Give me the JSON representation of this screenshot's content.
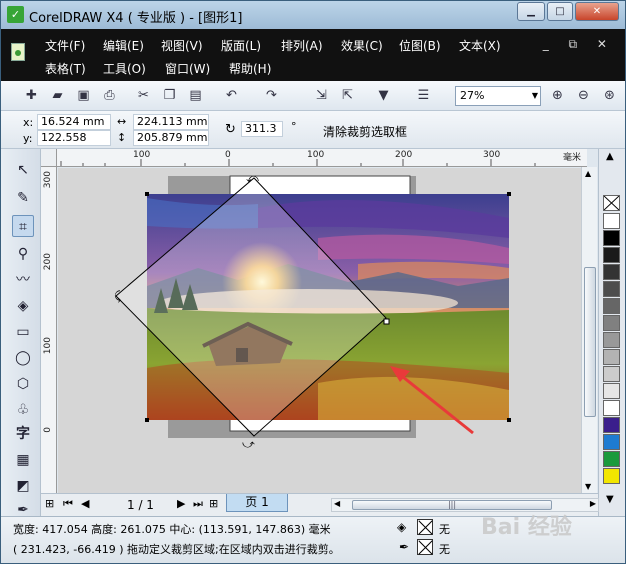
{
  "window": {
    "title": "CorelDRAW X4 ( 专业版 ) - [图形1]",
    "minimize_label": "▁",
    "maximize_label": "□",
    "close_label": "✕"
  },
  "menu": {
    "row1": [
      "文件(F)",
      "编辑(E)",
      "视图(V)",
      "版面(L)",
      "排列(A)",
      "效果(C)",
      "位图(B)",
      "文本(X)"
    ],
    "row2": [
      "表格(T)",
      "工具(O)",
      "窗口(W)",
      "帮助(H)"
    ],
    "mdi_controls": "_ ⧉ ✕"
  },
  "toolbar": {
    "zoom_value": "27%"
  },
  "property_bar": {
    "x_label": "x:",
    "x_value": "16.524 mm",
    "y_label": "y:",
    "y_value": "122.558 mm",
    "width_value": "224.113 mm",
    "height_value": "205.879 mm",
    "rotation_value": "311.3",
    "rotation_unit": "°",
    "clear_crop_label": "清除裁剪选取框"
  },
  "rulers": {
    "h_labels": [
      "100",
      "0",
      "100",
      "200",
      "300"
    ],
    "h_unit": "毫米",
    "v_labels": [
      "300",
      "200",
      "100",
      "0"
    ]
  },
  "page_bar": {
    "page_count": "1 / 1",
    "page_tab": "页 1"
  },
  "status": {
    "line1": "宽度: 417.054  高度: 261.075  中心: (113.591, 147.863)  毫米",
    "line2": "( 231.423, -66.419 )     拖动定义裁剪区域;在区域内双击进行裁剪。",
    "fill_label": "无",
    "outline_label": "无"
  },
  "palette_colors": [
    "#ffffff",
    "#000000",
    "#1a1a1a",
    "#333333",
    "#4d4d4d",
    "#666666",
    "#808080",
    "#999999",
    "#b3b3b3",
    "#cccccc",
    "#e6e6e6",
    "#ffffff",
    "#3a1e8c",
    "#1e7bd1",
    "#1a9a3c",
    "#f2e600"
  ],
  "watermark": "Bai 经验"
}
